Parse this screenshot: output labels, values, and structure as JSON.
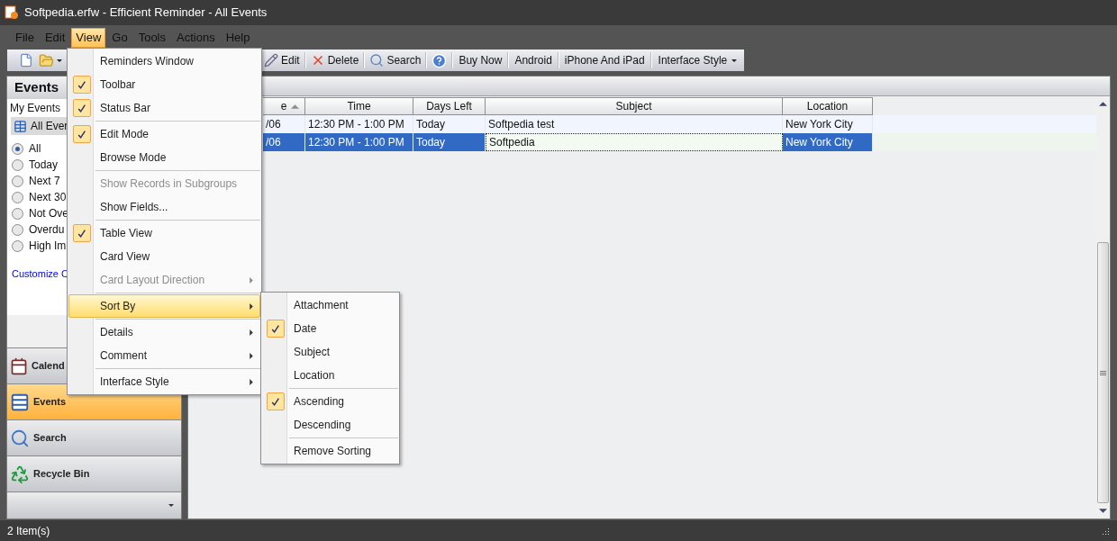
{
  "window": {
    "title": "Softpedia.erfw - Efficient Reminder - All Events"
  },
  "menu_bar": [
    {
      "label": "File",
      "selected": false
    },
    {
      "label": "Edit",
      "selected": false
    },
    {
      "label": "View",
      "selected": true
    },
    {
      "label": "Go",
      "selected": false
    },
    {
      "label": "Tools",
      "selected": false
    },
    {
      "label": "Actions",
      "selected": false
    },
    {
      "label": "Help",
      "selected": false
    }
  ],
  "toolbar": [
    {
      "kind": "new"
    },
    {
      "kind": "open"
    },
    {
      "kind": "edit",
      "label": "Edit"
    },
    {
      "kind": "delete",
      "label": "Delete"
    },
    {
      "kind": "search",
      "label": "Search"
    },
    {
      "kind": "help"
    },
    {
      "kind": "text",
      "label": "Buy Now"
    },
    {
      "kind": "text",
      "label": "Android"
    },
    {
      "kind": "text",
      "label": "iPhone And iPad"
    },
    {
      "kind": "dropdown",
      "label": "Interface Style"
    }
  ],
  "sidebar": {
    "title": "Events",
    "group_label": "My Events",
    "current_view": "All Ever",
    "filters": [
      {
        "label": "All",
        "selected": true
      },
      {
        "label": "Today",
        "selected": false
      },
      {
        "label": "Next 7",
        "selected": false
      },
      {
        "label": "Next 30",
        "selected": false
      },
      {
        "label": "Not Ove",
        "selected": false
      },
      {
        "label": "Overdu",
        "selected": false
      },
      {
        "label": "High Im",
        "selected": false
      }
    ],
    "link": "Customize C",
    "nav": [
      {
        "kind": "calendar",
        "label": "Calend",
        "selected": false
      },
      {
        "kind": "events",
        "label": "Events",
        "selected": true
      },
      {
        "kind": "search",
        "label": "Search",
        "selected": false
      },
      {
        "kind": "recycle",
        "label": "Recycle Bin",
        "selected": false
      }
    ]
  },
  "table": {
    "columns": [
      {
        "label": "e",
        "sorted": true
      },
      {
        "label": "Time",
        "sorted": false
      },
      {
        "label": "Days Left",
        "sorted": false
      },
      {
        "label": "Subject",
        "sorted": false
      },
      {
        "label": "Location",
        "sorted": false
      }
    ],
    "rows": [
      {
        "selected": false,
        "cells": [
          {
            "text": "/06",
            "focused": false
          },
          {
            "text": "12:30 PM - 1:00 PM",
            "focused": false
          },
          {
            "text": "Today",
            "focused": false
          },
          {
            "text": "Softpedia test",
            "focused": false
          },
          {
            "text": "New York City",
            "focused": false
          }
        ]
      },
      {
        "selected": true,
        "cells": [
          {
            "text": "/06",
            "focused": false
          },
          {
            "text": "12:30 PM - 1:00 PM",
            "focused": false
          },
          {
            "text": "Today",
            "focused": false
          },
          {
            "text": "Softpedia",
            "focused": true
          },
          {
            "text": "New York City",
            "focused": false
          }
        ]
      }
    ]
  },
  "view_menu": {
    "items": [
      {
        "kind": "item",
        "label": "Reminders Window",
        "checked": false,
        "disabled": false,
        "submenu": false,
        "selected": false
      },
      {
        "kind": "item",
        "label": "Toolbar",
        "checked": true,
        "disabled": false,
        "submenu": false,
        "selected": false
      },
      {
        "kind": "item",
        "label": "Status Bar",
        "checked": true,
        "disabled": false,
        "submenu": false,
        "selected": false
      },
      {
        "kind": "separator"
      },
      {
        "kind": "item",
        "label": "Edit Mode",
        "checked": true,
        "disabled": false,
        "submenu": false,
        "selected": false
      },
      {
        "kind": "item",
        "label": "Browse Mode",
        "checked": false,
        "disabled": false,
        "submenu": false,
        "selected": false
      },
      {
        "kind": "separator"
      },
      {
        "kind": "item",
        "label": "Show Records in Subgroups",
        "checked": false,
        "disabled": true,
        "submenu": false,
        "selected": false
      },
      {
        "kind": "item",
        "label": "Show Fields...",
        "checked": false,
        "disabled": false,
        "submenu": false,
        "selected": false
      },
      {
        "kind": "separator"
      },
      {
        "kind": "item",
        "label": "Table View",
        "checked": true,
        "disabled": false,
        "submenu": false,
        "selected": false
      },
      {
        "kind": "item",
        "label": "Card View",
        "checked": false,
        "disabled": false,
        "submenu": false,
        "selected": false
      },
      {
        "kind": "item",
        "label": "Card Layout Direction",
        "checked": false,
        "disabled": true,
        "submenu": true,
        "selected": false
      },
      {
        "kind": "separator"
      },
      {
        "kind": "item",
        "label": "Sort By",
        "checked": false,
        "disabled": false,
        "submenu": true,
        "selected": true
      },
      {
        "kind": "separator"
      },
      {
        "kind": "item",
        "label": "Details",
        "checked": false,
        "disabled": false,
        "submenu": true,
        "selected": false
      },
      {
        "kind": "item",
        "label": "Comment",
        "checked": false,
        "disabled": false,
        "submenu": true,
        "selected": false
      },
      {
        "kind": "separator"
      },
      {
        "kind": "item",
        "label": "Interface Style",
        "checked": false,
        "disabled": false,
        "submenu": true,
        "selected": false
      }
    ]
  },
  "sort_menu": {
    "items": [
      {
        "kind": "item",
        "label": "Attachment",
        "checked": false,
        "disabled": false,
        "submenu": false,
        "selected": false
      },
      {
        "kind": "item",
        "label": "Date",
        "checked": true,
        "disabled": false,
        "submenu": false,
        "selected": false
      },
      {
        "kind": "item",
        "label": "Subject",
        "checked": false,
        "disabled": false,
        "submenu": false,
        "selected": false
      },
      {
        "kind": "item",
        "label": "Location",
        "checked": false,
        "disabled": false,
        "submenu": false,
        "selected": false
      },
      {
        "kind": "separator"
      },
      {
        "kind": "item",
        "label": "Ascending",
        "checked": true,
        "disabled": false,
        "submenu": false,
        "selected": false
      },
      {
        "kind": "item",
        "label": "Descending",
        "checked": false,
        "disabled": false,
        "submenu": false,
        "selected": false
      },
      {
        "kind": "separator"
      },
      {
        "kind": "item",
        "label": "Remove Sorting",
        "checked": false,
        "disabled": false,
        "submenu": false,
        "selected": false
      }
    ]
  },
  "status_bar": {
    "text": "2 Item(s)"
  }
}
